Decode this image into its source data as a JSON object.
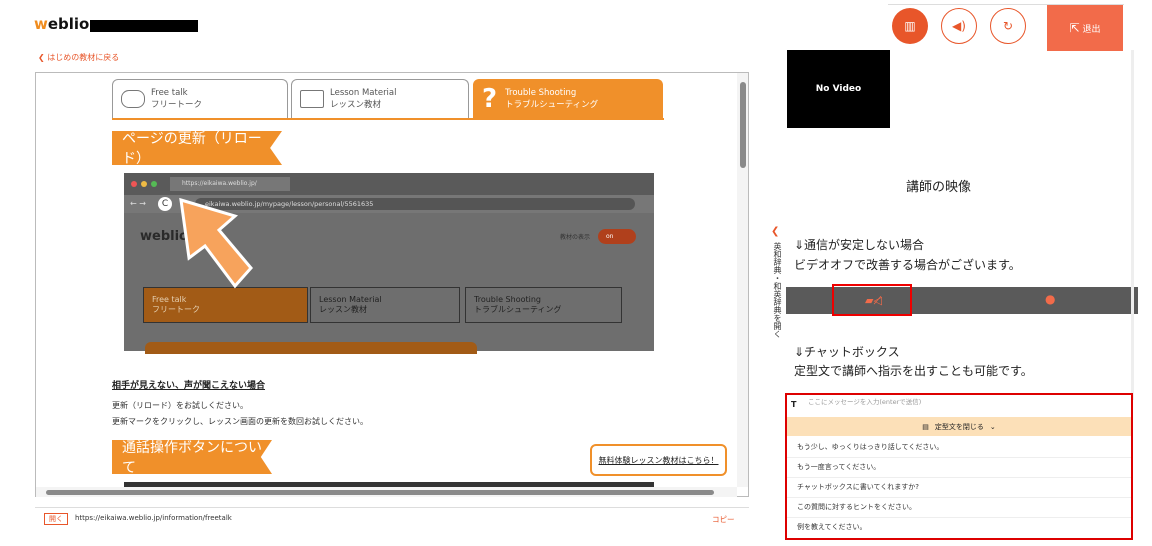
{
  "header": {
    "logo_accent": "w",
    "logo_rest": "eblio",
    "back_link": "❮  はじめの教材に戻る",
    "exit_label": "退出"
  },
  "tabs": [
    {
      "en": "Free talk",
      "ja": "フリートーク"
    },
    {
      "en": "Lesson Material",
      "ja": "レッスン教材"
    },
    {
      "en": "Trouble Shooting",
      "ja": "トラブルシューティング"
    }
  ],
  "section1": {
    "banner": "ページの更新（リロード）",
    "heading": "相手が見えない、声が聞こえない場合",
    "line1": "更新（リロード）をお試しください。",
    "line2": "更新マークをクリックし、レッスン画面の更新を数回お試しください。"
  },
  "section2": {
    "banner": "通話操作ボタンについて"
  },
  "inner_screenshot": {
    "tab_url": "https://eikaiwa.weblio.jp/",
    "url": "eikaiwa.weblio.jp/mypage/lesson/personal/5561635",
    "logo": "weblio",
    "material_label": "教材の表示",
    "toggle": "on",
    "tabs": [
      {
        "en": "Free talk",
        "ja": "フリートーク"
      },
      {
        "en": "Lesson Material",
        "ja": "レッスン教材"
      },
      {
        "en": "Trouble Shooting",
        "ja": "トラブルシューティング"
      }
    ]
  },
  "trial_link": "無料体験レッスン教材はこちら！",
  "urlbar": {
    "open": "開く",
    "url": "https://eikaiwa.weblio.jp/information/freetalk",
    "copy": "コピー"
  },
  "right": {
    "video_label": "No Video",
    "lecturer_video": "講師の映像",
    "note1a": "⇓通信が安定しない場合",
    "note1b": "ビデオオフで改善する場合がございます。",
    "note2a": "⇓チャットボックス",
    "note2b": "定型文で講師へ指示を出すことも可能です。",
    "side_tab": "英和辞典・和英辞典を開く"
  },
  "chat": {
    "placeholder": "ここにメッセージを入力(enterで送信)",
    "phrase_toggle": "定型文を閉じる",
    "phrases": [
      "もう少し、ゆっくりはっきり話してください。",
      "もう一度言ってください。",
      "チャットボックスに書いてくれますか?",
      "この質問に対するヒントをください。",
      "例を教えてください。"
    ]
  },
  "colors": {
    "accent": "#f0902a",
    "brand": "#e8562a"
  }
}
